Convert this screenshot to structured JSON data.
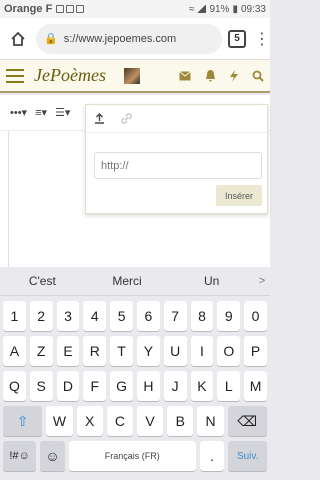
{
  "status_bar": {
    "carrier": "Orange F",
    "battery": "91%",
    "time": "09:33"
  },
  "browser": {
    "url": "s://www.jepoemes.com",
    "tab_count": "5",
    "menu_glyph": "⋮",
    "lock_glyph": "🔒"
  },
  "site": {
    "logo": "JePoèmes",
    "icons": [
      "envelope-icon",
      "bell-icon",
      "lightning-icon",
      "search-icon"
    ]
  },
  "editor": {
    "toolbar": [
      "•••▾",
      "≡▾",
      "☰▾"
    ]
  },
  "popup": {
    "tabs": [
      "upload-icon",
      "link-icon"
    ],
    "input_placeholder": "http://",
    "insert_label": "Insérer"
  },
  "keyboard": {
    "suggestions": [
      "C'est",
      "Merci",
      "Un"
    ],
    "suggestion_arrow": ">",
    "row_numbers": [
      "1",
      "2",
      "3",
      "4",
      "5",
      "6",
      "7",
      "8",
      "9",
      "0"
    ],
    "row1": [
      "A",
      "Z",
      "E",
      "R",
      "T",
      "Y",
      "U",
      "I",
      "O",
      "P"
    ],
    "row2": [
      "Q",
      "S",
      "D",
      "F",
      "G",
      "H",
      "J",
      "K",
      "L",
      "M"
    ],
    "row3": [
      "W",
      "X",
      "C",
      "V",
      "B",
      "N"
    ],
    "shift_glyph": "⇧",
    "backspace_glyph": "⌫",
    "sym_label": "!#☺",
    "emoji_glyph": "☺",
    "space_label": "Français (FR)",
    "period": ".",
    "enter_label": "Suiv."
  },
  "colors": {
    "accent": "#8a7a1e",
    "header_bg": "#fbf9ec",
    "enter": "#3b8dd0"
  }
}
